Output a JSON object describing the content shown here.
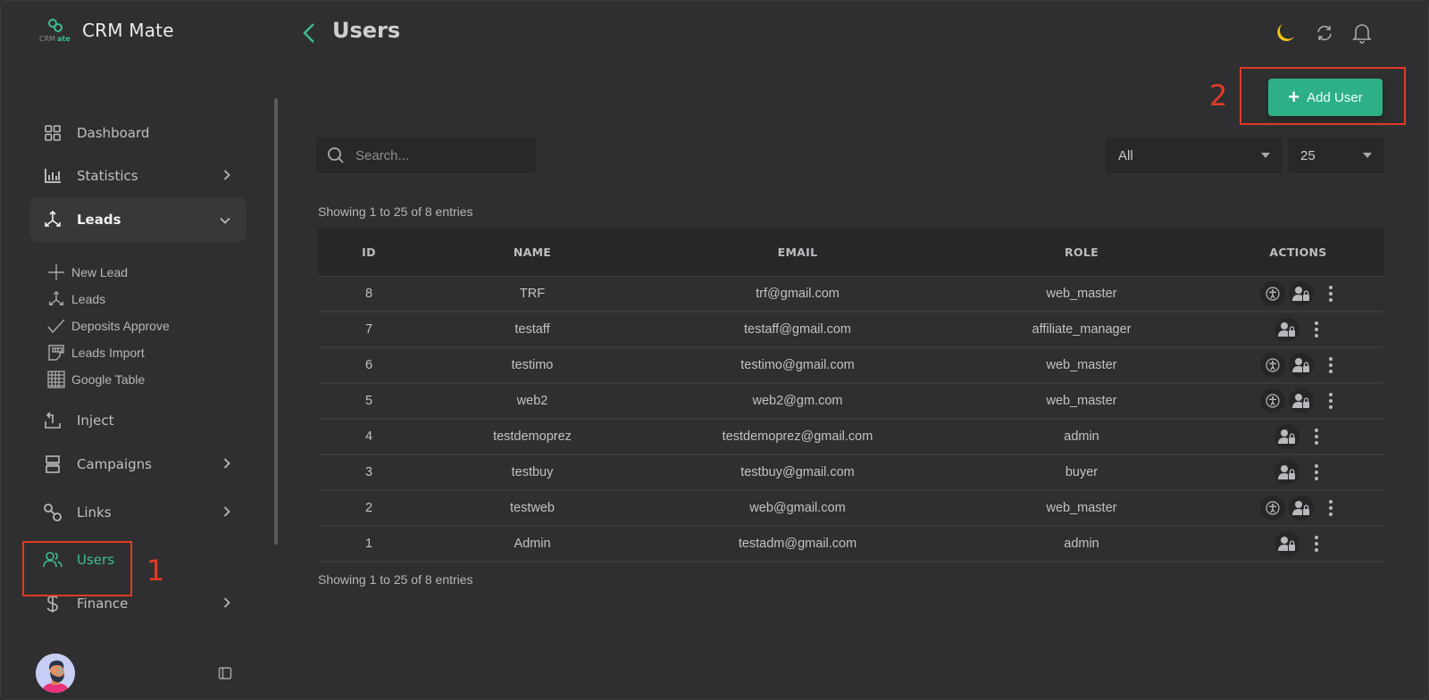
{
  "app": {
    "name": "CRM Mate",
    "logo_text": "CRMate"
  },
  "colors": {
    "accent": "#2daf88",
    "active_nav": "#3dbd93",
    "annotation": "#e03a26",
    "moon": "#f5c518"
  },
  "sidebar": {
    "items": [
      {
        "label": "Dashboard",
        "icon": "dashboard-grid-icon",
        "has_chevron": false
      },
      {
        "label": "Statistics",
        "icon": "bar-chart-icon",
        "has_chevron": true
      },
      {
        "label": "Leads",
        "icon": "leads-branch-icon",
        "has_chevron": true,
        "expanded": true
      },
      {
        "label": "Inject",
        "icon": "inject-icon",
        "has_chevron": false
      },
      {
        "label": "Campaigns",
        "icon": "campaigns-icon",
        "has_chevron": true
      },
      {
        "label": "Links",
        "icon": "link-icon",
        "has_chevron": true
      },
      {
        "label": "Users",
        "icon": "users-icon",
        "has_chevron": false,
        "active": true
      },
      {
        "label": "Finance",
        "icon": "dollar-icon",
        "has_chevron": true
      }
    ],
    "leads_submenu": [
      {
        "label": "New Lead",
        "icon": "plus-icon"
      },
      {
        "label": "Leads",
        "icon": "leads-branch-icon"
      },
      {
        "label": "Deposits Approve",
        "icon": "check-icon"
      },
      {
        "label": "Leads Import",
        "icon": "import-icon"
      },
      {
        "label": "Google Table",
        "icon": "table-grid-icon"
      }
    ]
  },
  "annotations": {
    "one": "1",
    "two": "2"
  },
  "header": {
    "title": "Users",
    "icons": [
      "moon-icon",
      "refresh-icon",
      "bell-icon"
    ]
  },
  "toolbar": {
    "add_user_label": "Add User",
    "search_placeholder": "Search...",
    "search_value": "",
    "role_filter": "All",
    "page_size": "25"
  },
  "summary": {
    "top": "Showing 1 to 25 of 8 entries",
    "bottom": "Showing 1 to 25 of 8 entries"
  },
  "table": {
    "columns": [
      "ID",
      "NAME",
      "EMAIL",
      "ROLE",
      "ACTIONS"
    ],
    "rows": [
      {
        "id": "8",
        "name": "TRF",
        "email": "trf@gmail.com",
        "role": "web_master",
        "actions": [
          "accessibility-icon",
          "user-lock-icon",
          "kebab-menu-icon"
        ]
      },
      {
        "id": "7",
        "name": "testaff",
        "email": "testaff@gmail.com",
        "role": "affiliate_manager",
        "actions": [
          "user-lock-icon",
          "kebab-menu-icon"
        ]
      },
      {
        "id": "6",
        "name": "testimo",
        "email": "testimo@gmail.com",
        "role": "web_master",
        "actions": [
          "accessibility-icon",
          "user-lock-icon",
          "kebab-menu-icon"
        ]
      },
      {
        "id": "5",
        "name": "web2",
        "email": "web2@gm.com",
        "role": "web_master",
        "actions": [
          "accessibility-icon",
          "user-lock-icon",
          "kebab-menu-icon"
        ]
      },
      {
        "id": "4",
        "name": "testdemoprez",
        "email": "testdemoprez@gmail.com",
        "role": "admin",
        "actions": [
          "user-lock-icon",
          "kebab-menu-icon"
        ]
      },
      {
        "id": "3",
        "name": "testbuy",
        "email": "testbuy@gmail.com",
        "role": "buyer",
        "actions": [
          "user-lock-icon",
          "kebab-menu-icon"
        ]
      },
      {
        "id": "2",
        "name": "testweb",
        "email": "web@gmail.com",
        "role": "web_master",
        "actions": [
          "accessibility-icon",
          "user-lock-icon",
          "kebab-menu-icon"
        ]
      },
      {
        "id": "1",
        "name": "Admin",
        "email": "testadm@gmail.com",
        "role": "admin",
        "actions": [
          "user-lock-icon",
          "kebab-menu-icon"
        ]
      }
    ]
  }
}
